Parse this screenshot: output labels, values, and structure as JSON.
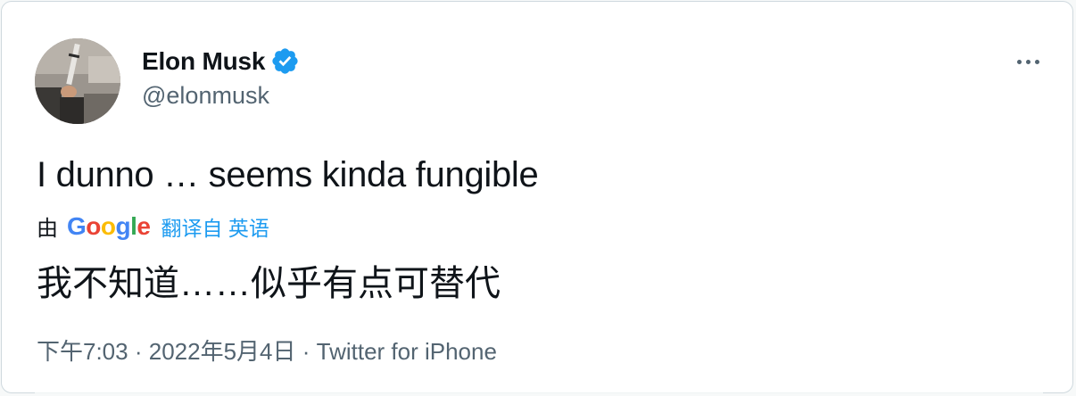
{
  "author": {
    "name": "Elon Musk",
    "handle": "@elonmusk"
  },
  "tweet": {
    "text": "I dunno … seems kinda fungible"
  },
  "translation": {
    "by_label": "由",
    "google_letters": [
      "G",
      "o",
      "o",
      "g",
      "l",
      "e"
    ],
    "google_colors": [
      "#4285F4",
      "#EA4335",
      "#FBBC05",
      "#4285F4",
      "#34A853",
      "#EA4335"
    ],
    "translate_link": "翻译自 英语",
    "translated_text": "我不知道……似乎有点可替代"
  },
  "meta": {
    "time": "下午7:03",
    "date": "2022年5月4日",
    "source": "Twitter for iPhone"
  },
  "colors": {
    "verified": "#1d9bf0",
    "link": "#1d9bf0",
    "secondary_text": "#536471"
  }
}
